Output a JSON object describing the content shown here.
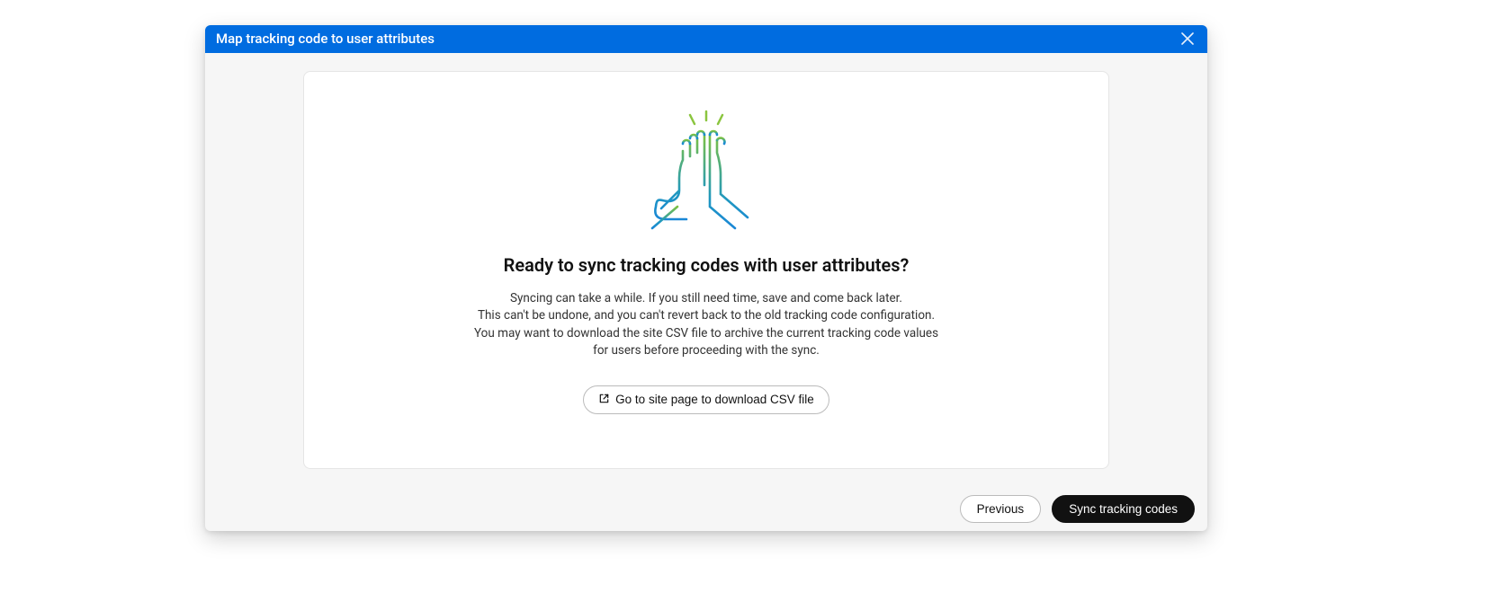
{
  "modal": {
    "title": "Map tracking code to user attributes",
    "heading": "Ready to sync tracking codes with user attributes?",
    "para1": "Syncing can take a while. If you still need time, save and come back later.",
    "para2": "This can't be undone, and you can't revert back to the old tracking code configuration.",
    "para3": "You may want to download the site CSV file to archive the current tracking code values for users before proceeding with the sync.",
    "csv_button_label": "Go to site page to download CSV file"
  },
  "footer": {
    "previous_label": "Previous",
    "sync_label": "Sync tracking codes"
  }
}
